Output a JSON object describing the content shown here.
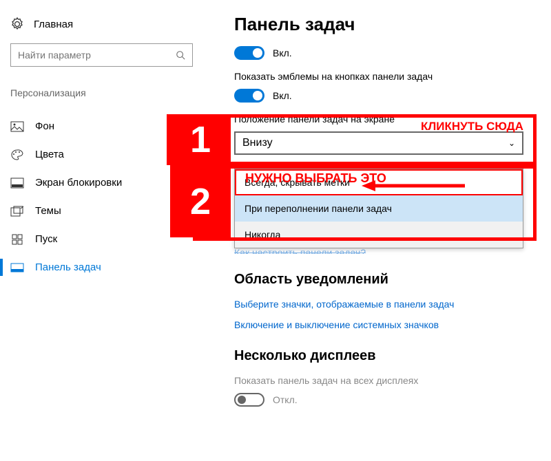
{
  "sidebar": {
    "home": "Главная",
    "search_placeholder": "Найти параметр",
    "section": "Персонализация",
    "items": [
      {
        "label": "Фон"
      },
      {
        "label": "Цвета"
      },
      {
        "label": "Экран блокировки"
      },
      {
        "label": "Темы"
      },
      {
        "label": "Пуск"
      },
      {
        "label": "Панель задач"
      }
    ]
  },
  "main": {
    "title": "Панель задач",
    "toggle1_state": "Вкл.",
    "badges_label": "Показать эмблемы на кнопках панели задач",
    "toggle2_state": "Вкл.",
    "position_label": "Положение панели задач на экране",
    "position_value": "Внизу",
    "dropdown_options": {
      "opt0": "Всегда, скрывать метки",
      "opt1": "При переполнении панели задач",
      "opt2": "Никогда"
    },
    "link_configure": "Как настроить панели задач?",
    "section_notif": "Область уведомлений",
    "link_icons": "Выберите значки, отображаемые в панели задач",
    "link_sysicons": "Включение и выключение системных значков",
    "section_multi": "Несколько дисплеев",
    "multi_label": "Показать панель задач на всех дисплеях",
    "toggle3_state": "Откл."
  },
  "annotations": {
    "num1": "1",
    "num2": "2",
    "click_here": "КЛИКНУТЬ СЮДА",
    "choose_this": "НУЖНО ВЫБРАТЬ ЭТО"
  }
}
